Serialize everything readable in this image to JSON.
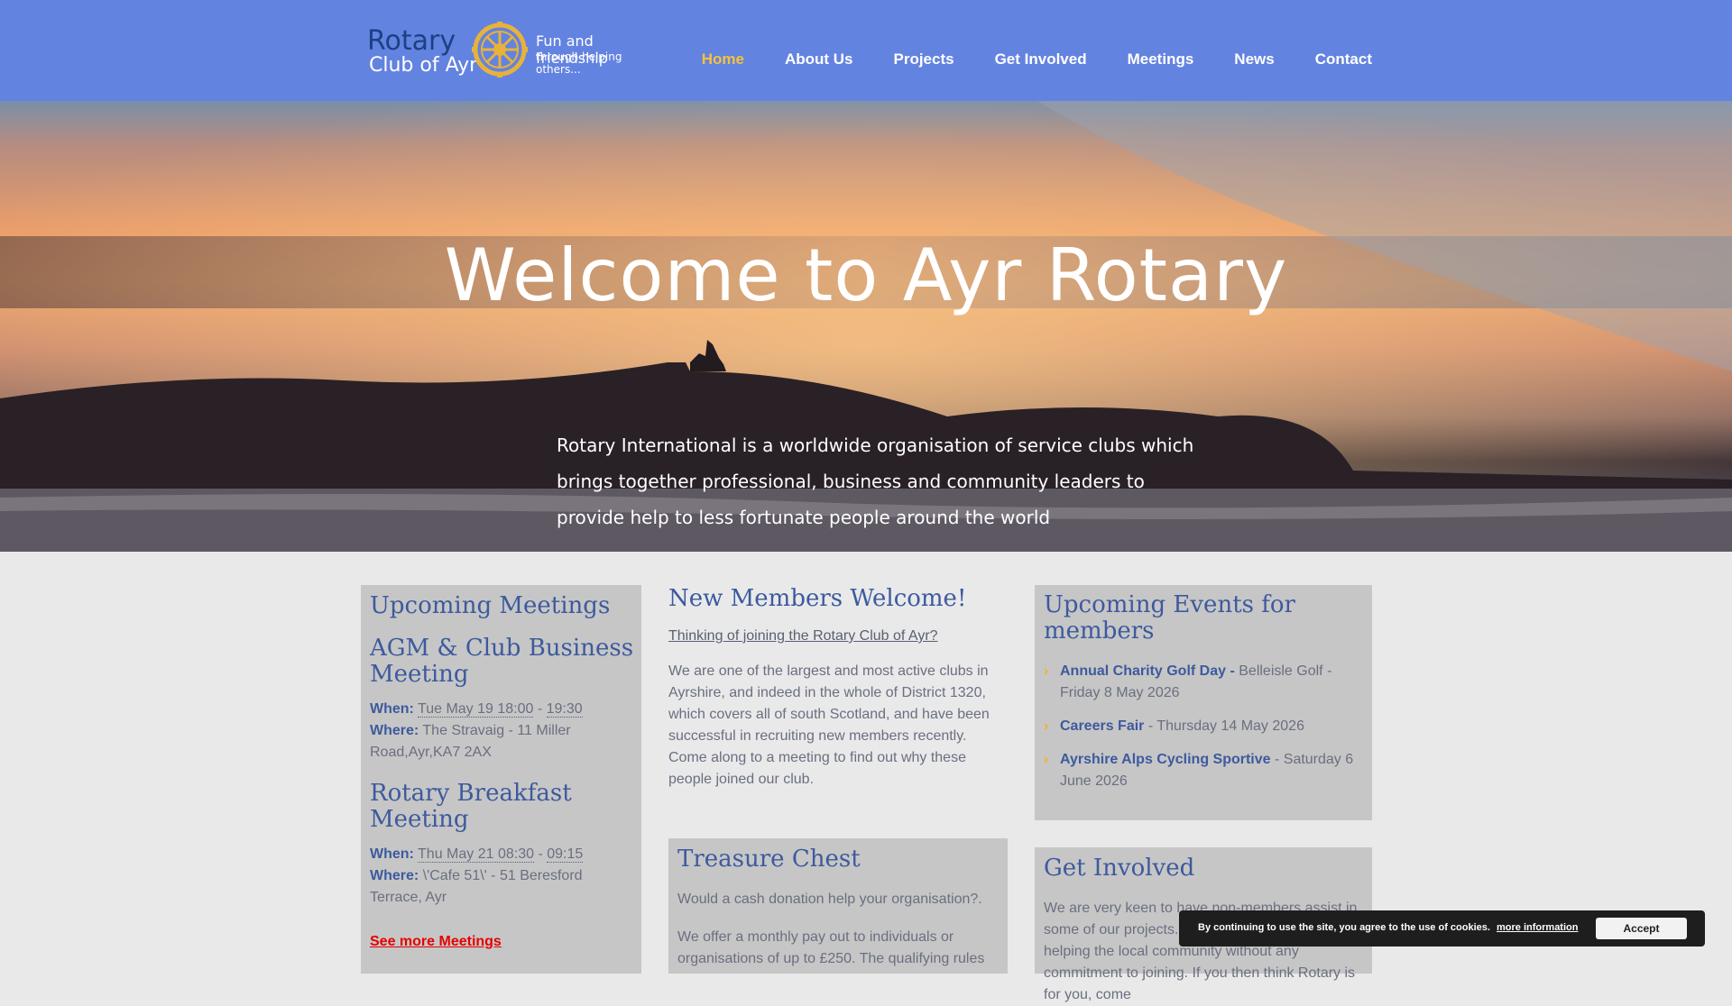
{
  "header": {
    "logo": {
      "line1": "Rotary",
      "line2": "Club of Ayr",
      "tagline1": "Fun and friendship",
      "tagline2": "through helping others..."
    },
    "nav": [
      "Home",
      "About Us",
      "Projects",
      "Get Involved",
      "Meetings",
      "News",
      "Contact"
    ],
    "active": "Home"
  },
  "hero": {
    "title": "Welcome to Ayr Rotary",
    "text": "Rotary International is a worldwide organisation of service clubs which brings together professional, business and community leaders to provide help to less fortunate people around the world"
  },
  "meetings": {
    "title": "Upcoming Meetings",
    "items": [
      {
        "name": "AGM & Club Business Meeting",
        "when_label": "When:",
        "when_start": "Tue May 19 18:00",
        "when_end": "19:30",
        "where_label": "Where:",
        "where": "The Stravaig - 11 Miller Road,Ayr,KA7 2AX"
      },
      {
        "name": "Rotary Breakfast Meeting",
        "when_label": "When:",
        "when_start": "Thu May 21 08:30",
        "when_end": "09:15",
        "where_label": "Where:",
        "where": "\\'Cafe 51\\' - 51 Beresford Terrace, Ayr"
      }
    ],
    "see_more": "See more Meetings"
  },
  "new_members": {
    "title": "New Members Welcome!",
    "link": "Thinking of joining the Rotary Club of Ayr?",
    "body": "We are one of the largest and most active clubs in Ayrshire, and indeed in the whole of District 1320, which covers all of south Scotland, and have been successful in recruiting new members recently. Come along to a meeting to find out why these  people joined our club."
  },
  "treasure": {
    "title": "Treasure Chest",
    "p1": "Would a cash donation help your organisation?.",
    "p2": "We offer a monthly pay out to individuals or organisations of up to £250. The qualifying rules"
  },
  "events": {
    "title": "Upcoming Events for members",
    "items": [
      {
        "name": "Annual Charity Golf Day -",
        "detail": " Belleisle Golf - Friday 8 May 2026"
      },
      {
        "name": "Careers Fair",
        "detail": " - Thursday 14 May 2026"
      },
      {
        "name": "Ayrshire Alps Cycling Sportive",
        "detail": " - Saturday 6 June 2026"
      }
    ]
  },
  "involved": {
    "title": "Get Involved",
    "body": "We are very keen to have non-members assist in some of our projects. This is a great way of helping the local community without any commitment to joining. If you then think Rotary is for you, come"
  },
  "cookie": {
    "text": "By continuing to use the site, you agree to the use of cookies.",
    "more": "more information",
    "accept": "Accept"
  },
  "colors": {
    "header_bg": "#6383e0",
    "nav_active": "#f6c23a",
    "heading": "#3d5a9e",
    "panel_bg": "#c6c6c6",
    "see_more": "#e60000"
  }
}
